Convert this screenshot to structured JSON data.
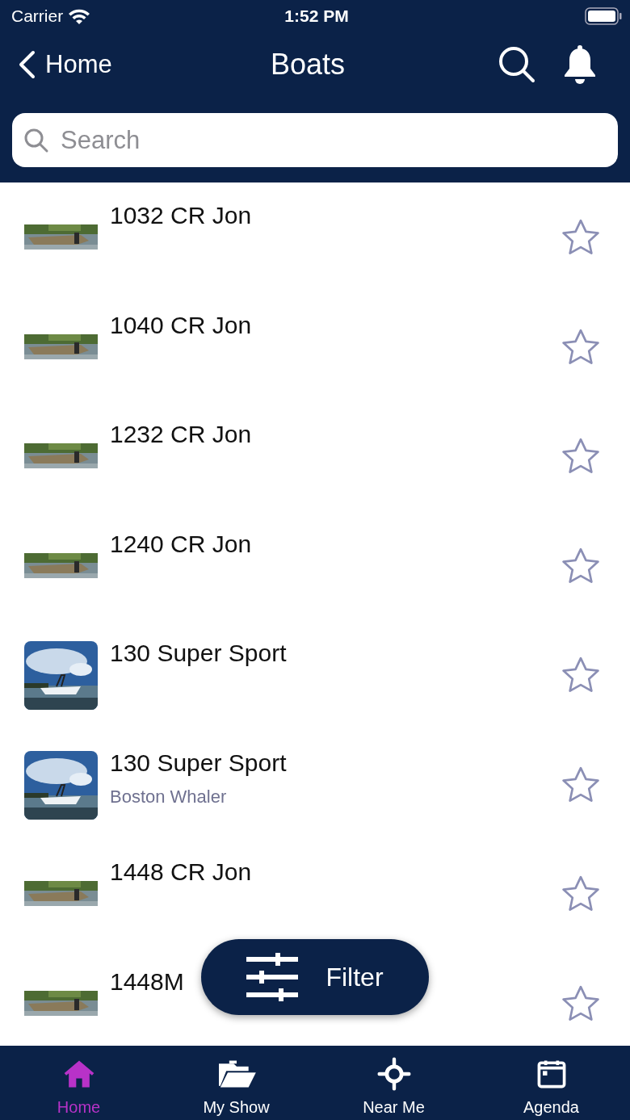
{
  "status_bar": {
    "carrier": "Carrier",
    "time": "1:52 PM"
  },
  "nav": {
    "back_label": "Home",
    "title": "Boats"
  },
  "search": {
    "placeholder": "Search"
  },
  "rows": [
    {
      "title": "1032 CR Jon",
      "kind": "strip",
      "favorite": false
    },
    {
      "title": "1040 CR Jon",
      "kind": "strip",
      "favorite": false
    },
    {
      "title": "1232 CR Jon",
      "kind": "strip",
      "favorite": false
    },
    {
      "title": "1240 CR Jon",
      "kind": "strip",
      "favorite": false
    },
    {
      "title": "130 Super Sport",
      "kind": "square",
      "favorite": false
    },
    {
      "title": "130 Super Sport",
      "subtitle": "Boston Whaler",
      "kind": "square",
      "favorite": false
    },
    {
      "title": "1448 CR Jon",
      "kind": "strip",
      "favorite": false
    },
    {
      "title": "1448M",
      "kind": "strip",
      "favorite": false
    }
  ],
  "filter_button": {
    "label": "Filter"
  },
  "tab_bar": [
    {
      "label": "Home",
      "kind": "home",
      "selected": true
    },
    {
      "label": "My Show",
      "kind": "folder",
      "selected": false
    },
    {
      "label": "Near Me",
      "kind": "locate",
      "selected": false
    },
    {
      "label": "Agenda",
      "kind": "calendar",
      "selected": false
    }
  ]
}
